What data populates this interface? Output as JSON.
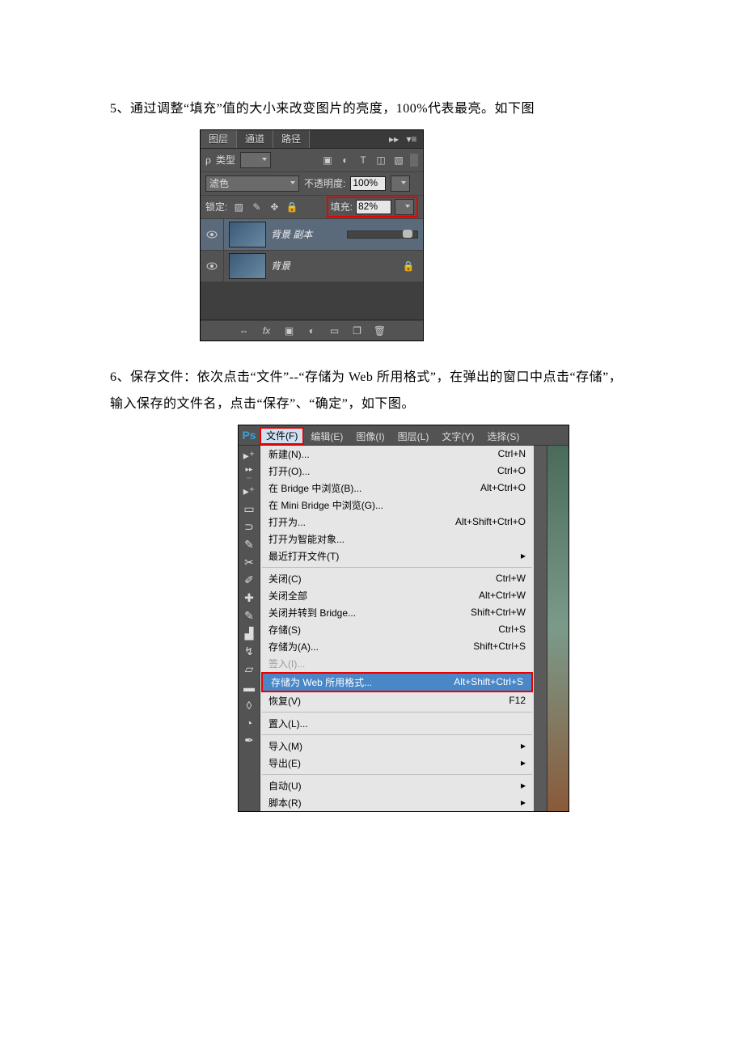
{
  "para1": "5、通过调整“填充”值的大小来改变图片的亮度，100%代表最亮。如下图",
  "para2": "6、保存文件：依次点击“文件”--“存储为 Web 所用格式”，在弹出的窗口中点击“存储”，输入保存的文件名，点击“保存”、“确定”，如下图。",
  "layers": {
    "tabs": {
      "layers": "图层",
      "channels": "通道",
      "paths": "路径"
    },
    "kind_label": "类型",
    "blend": "滤色",
    "opacity_label": "不透明度:",
    "opacity_value": "100%",
    "lock_label": "锁定:",
    "fill_label": "填充:",
    "fill_value": "82%",
    "layer_copy": "背景 副本",
    "layer_bg": "背景",
    "fx": "fx"
  },
  "ps": {
    "logo": "Ps",
    "menus": {
      "file": "文件(F)",
      "edit": "编辑(E)",
      "image": "图像(I)",
      "layer": "图层(L)",
      "type": "文字(Y)",
      "select": "选择(S)"
    },
    "items": [
      {
        "k": "new",
        "l": "新建(N)...",
        "s": "Ctrl+N"
      },
      {
        "k": "open",
        "l": "打开(O)...",
        "s": "Ctrl+O"
      },
      {
        "k": "browse",
        "l": "在 Bridge 中浏览(B)...",
        "s": "Alt+Ctrl+O"
      },
      {
        "k": "minibrowse",
        "l": "在 Mini Bridge 中浏览(G)..."
      },
      {
        "k": "openas",
        "l": "打开为...",
        "s": "Alt+Shift+Ctrl+O"
      },
      {
        "k": "opensmart",
        "l": "打开为智能对象..."
      },
      {
        "k": "recent",
        "l": "最近打开文件(T)",
        "sub": true
      },
      {
        "sep": true
      },
      {
        "k": "close",
        "l": "关闭(C)",
        "s": "Ctrl+W"
      },
      {
        "k": "closeall",
        "l": "关闭全部",
        "s": "Alt+Ctrl+W"
      },
      {
        "k": "closego",
        "l": "关闭并转到 Bridge...",
        "s": "Shift+Ctrl+W"
      },
      {
        "k": "save",
        "l": "存储(S)",
        "s": "Ctrl+S"
      },
      {
        "k": "saveas",
        "l": "存储为(A)...",
        "s": "Shift+Ctrl+S"
      },
      {
        "k": "checkin",
        "l": "签入(I)...",
        "dis": true
      },
      {
        "k": "saveweb",
        "l": "存储为 Web 所用格式...",
        "s": "Alt+Shift+Ctrl+S",
        "hl": true
      },
      {
        "k": "revert",
        "l": "恢复(V)",
        "s": "F12"
      },
      {
        "sep": true
      },
      {
        "k": "place",
        "l": "置入(L)..."
      },
      {
        "sep": true
      },
      {
        "k": "import",
        "l": "导入(M)",
        "sub": true
      },
      {
        "k": "export",
        "l": "导出(E)",
        "sub": true
      },
      {
        "sep": true
      },
      {
        "k": "automate",
        "l": "自动(U)",
        "sub": true
      },
      {
        "k": "scripts",
        "l": "脚本(R)",
        "sub": true
      }
    ]
  }
}
